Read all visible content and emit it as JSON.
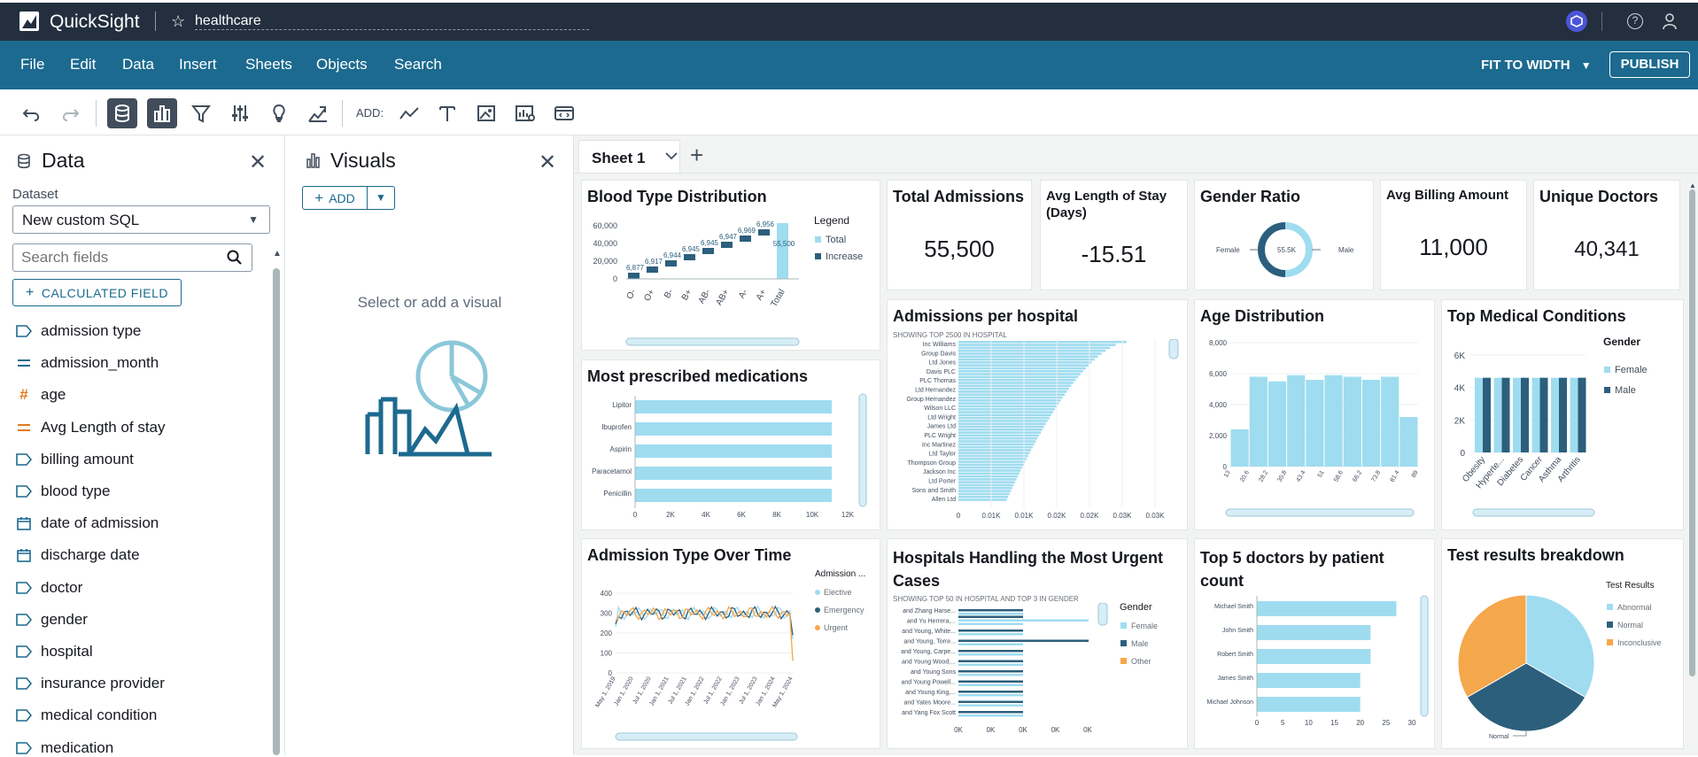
{
  "topbar": {
    "brand": "QuickSight",
    "analysis_name": "healthcare"
  },
  "menu": {
    "items": [
      "File",
      "Edit",
      "Data",
      "Insert",
      "Sheets",
      "Objects",
      "Search"
    ],
    "fit": "FIT TO WIDTH",
    "publish": "PUBLISH"
  },
  "toolbar": {
    "add_label": "ADD:"
  },
  "data_panel": {
    "title": "Data",
    "dataset_label": "Dataset",
    "dataset_value": "New custom SQL",
    "search_placeholder": "Search fields",
    "calc_field": "CALCULATED FIELD",
    "fields": [
      {
        "name": "admission type",
        "type": "dim"
      },
      {
        "name": "admission_month",
        "type": "measure-blue"
      },
      {
        "name": "age",
        "type": "hash"
      },
      {
        "name": "Avg Length of stay",
        "type": "measure-orange"
      },
      {
        "name": "billing amount",
        "type": "dim"
      },
      {
        "name": "blood type",
        "type": "dim"
      },
      {
        "name": "date of admission",
        "type": "date"
      },
      {
        "name": "discharge date",
        "type": "date"
      },
      {
        "name": "doctor",
        "type": "dim"
      },
      {
        "name": "gender",
        "type": "dim"
      },
      {
        "name": "hospital",
        "type": "dim"
      },
      {
        "name": "insurance provider",
        "type": "dim"
      },
      {
        "name": "medical condition",
        "type": "dim"
      },
      {
        "name": "medication",
        "type": "dim"
      }
    ]
  },
  "visuals_panel": {
    "title": "Visuals",
    "add": "ADD",
    "empty_text": "Select or add a visual"
  },
  "sheet": {
    "tab": "Sheet 1"
  },
  "kpis": [
    {
      "title": "Total Admissions",
      "value": "55,500"
    },
    {
      "title": "Avg Length of Stay (Days)",
      "value": "-15.51"
    },
    {
      "title": "Avg Billing Amount",
      "value": "11,000"
    },
    {
      "title": "Unique Doctors",
      "value": "40,341"
    }
  ],
  "gender_ratio": {
    "title": "Gender Ratio",
    "center": "55.5K",
    "left": "Female",
    "right": "Male"
  },
  "blood_type": {
    "title": "Blood Type Distribution",
    "legend_title": "Legend",
    "legend": [
      "Total",
      "Increase"
    ],
    "categories": [
      "O-",
      "O+",
      "B-",
      "B+",
      "AB-",
      "AB+",
      "A-",
      "A+",
      "Total"
    ],
    "value_labels": [
      "6,877",
      "6,917",
      "6,944",
      "6,945",
      "6,945",
      "6,947",
      "6,969",
      "6,956",
      "55,500"
    ],
    "yticks": [
      "60,000",
      "40,000",
      "20,000",
      "0"
    ]
  },
  "admissions_hospital": {
    "title": "Admissions per hospital",
    "subtitle": "SHOWING TOP 2500 IN HOSPITAL",
    "labels": [
      "Inc Williams",
      "Group Davis",
      "Ltd Jones",
      "Davis PLC",
      "PLC Thomas",
      "Ltd Hernandez",
      "Group Hernandez",
      "Wilson LLC",
      "Ltd Wright",
      "James Ltd",
      "PLC Wright",
      "Inc Martinez",
      "Ltd Taylor",
      "Thompson Group",
      "Jackson Inc",
      "Ltd Porter",
      "Sons and Smith",
      "Allen Ltd"
    ],
    "xticks": [
      "0",
      "0.01K",
      "0.01K",
      "0.02K",
      "0.02K",
      "0.03K",
      "0.03K"
    ]
  },
  "age_dist": {
    "title": "Age Distribution",
    "yticks": [
      "8,000",
      "6,000",
      "4,000",
      "2,000",
      "0"
    ],
    "xticks": [
      "13",
      "20.6",
      "28.2",
      "35.8",
      "43.4",
      "51",
      "58.6",
      "66.2",
      "73.8",
      "81.4",
      "89"
    ],
    "values": [
      2400,
      5800,
      5500,
      5900,
      5600,
      5900,
      5800,
      5600,
      5800,
      3200
    ]
  },
  "top_conditions": {
    "title": "Top Medical Conditions",
    "legend_title": "Gender",
    "legend": [
      "Female",
      "Male"
    ],
    "categories": [
      "Obesity",
      "Hyperte...",
      "Diabetes",
      "Cancer",
      "Asthma",
      "Arthritis"
    ],
    "yticks": [
      "6K",
      "4K",
      "2K",
      "0"
    ]
  },
  "medications": {
    "title": "Most prescribed medications",
    "labels": [
      "Lipitor",
      "Ibuprofen",
      "Aspirin",
      "Paracetamol",
      "Penicillin"
    ],
    "values": [
      11100,
      11100,
      11100,
      11100,
      11100
    ],
    "xticks": [
      "0",
      "2K",
      "4K",
      "6K",
      "8K",
      "10K",
      "12K"
    ]
  },
  "admission_time": {
    "title": "Admission Type Over Time",
    "legend_title": "Admission ...",
    "legend": [
      "Elective",
      "Emergency",
      "Urgent"
    ],
    "yticks": [
      "400",
      "300",
      "200",
      "100",
      "0"
    ],
    "xticks": [
      "May 1, 2019",
      "Jan 1, 2020",
      "Jul 1, 2020",
      "Jan 1, 2021",
      "Jul 1, 2021",
      "Jan 1, 2022",
      "Jul 1, 2022",
      "Jan 1, 2023",
      "Jul 1, 2023",
      "Jan 1, 2024",
      "May 1, 2024"
    ]
  },
  "urgent_cases": {
    "title": "Hospitals Handling the Most Urgent Cases",
    "subtitle": "SHOWING TOP 50 IN HOSPITAL AND TOP 3 IN GENDER",
    "legend_title": "Gender",
    "legend": [
      "Female",
      "Male",
      "Other"
    ],
    "labels": [
      "and Zhang Harse...",
      "and Yu Herrera,...",
      "and Young, White...",
      "and Young, Torre...",
      "and Young, Carpe...",
      "and Young Wood,...",
      "and Young Sons",
      "and Young Powell...",
      "and Young King,...",
      "and Yates Moore...",
      "and Yang Fox Scott"
    ],
    "xticks": [
      "0K",
      "0K",
      "0K",
      "0K",
      "0K"
    ]
  },
  "top_doctors": {
    "title": "Top 5 doctors by patient count",
    "labels": [
      "Michael Smith",
      "John Smith",
      "Robert Smith",
      "James Smith",
      "Michael Johnson"
    ],
    "values": [
      27,
      22,
      22,
      20,
      20
    ],
    "xticks": [
      "0",
      "5",
      "10",
      "15",
      "20",
      "25",
      "30"
    ]
  },
  "test_results": {
    "title": "Test results breakdown",
    "legend_title": "Test Results",
    "legend": [
      "Abnormal",
      "Normal",
      "Inconclusive"
    ],
    "bottom_label": "Normal"
  },
  "colors": {
    "light_blue": "#9fdcf0",
    "dark_blue": "#2c5f7c",
    "orange": "#f5a74c",
    "menubar": "#1c6a8f",
    "topbar": "#232f3e"
  }
}
